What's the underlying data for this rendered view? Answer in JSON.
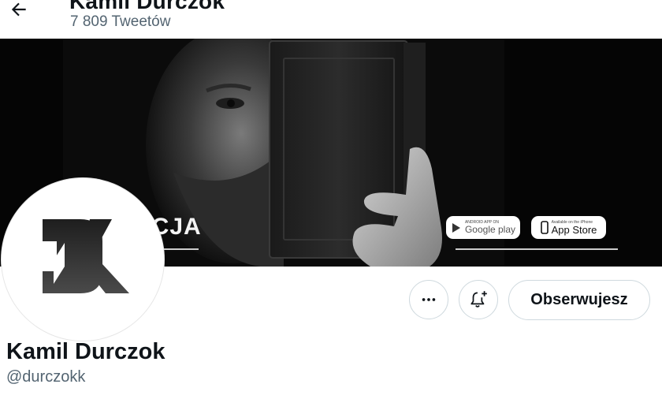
{
  "header": {
    "title": "Kamil Durczok",
    "tweets_count": "7 809 Tweetów",
    "back_icon": "arrow-left-icon"
  },
  "banner": {
    "text": "ACJA",
    "google_play": {
      "small": "ANDROID APP ON",
      "big": "Google play"
    },
    "app_store": {
      "small": "Available on the iPhone",
      "big": "App Store"
    }
  },
  "avatar": {
    "logo_letters": "DK"
  },
  "actions": {
    "more_icon": "more-horizontal-icon",
    "notify_icon": "bell-plus-icon",
    "follow_label": "Obserwujesz"
  },
  "profile": {
    "name": "Kamil Durczok",
    "handle": "@durczokk"
  },
  "colors": {
    "text_primary": "#0f1419",
    "text_secondary": "#536471",
    "border": "#cfd9de",
    "banner_bg": "#050505"
  }
}
